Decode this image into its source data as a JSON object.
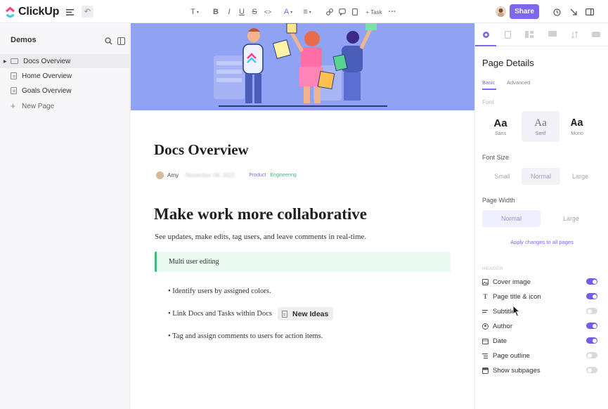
{
  "app": {
    "name": "ClickUp"
  },
  "toolbar": {
    "text_format": "T",
    "bold": "B",
    "italic": "I",
    "underline": "U",
    "strike": "S",
    "code": "<>",
    "text_color": "A",
    "align": "≡",
    "add_task": "+ Task",
    "more": "···",
    "share_label": "Share"
  },
  "sidebar": {
    "title": "Demos",
    "items": [
      {
        "label": "Docs Overview",
        "active": true
      },
      {
        "label": "Home Overview"
      },
      {
        "label": "Goals Overview"
      }
    ],
    "new_page": "New Page"
  },
  "doc": {
    "title": "Docs Overview",
    "author": "Amy",
    "date_blurred": "November 08, 2022",
    "tags": [
      "Product",
      "Engineering"
    ],
    "heading": "Make work more collaborative",
    "lead": "See updates, make edits, tag users, and leave comments in real-time.",
    "callout": "Multi user editing",
    "bullets": [
      "• Identify users by assigned colors.",
      "• Link Docs and Tasks within Docs",
      "• Tag and assign comments to users for action items."
    ],
    "linked_doc_chip": "New Ideas"
  },
  "panel": {
    "title": "Page Details",
    "subtabs": [
      "Basic",
      "Advanced"
    ],
    "font_label": "Font",
    "fonts": [
      {
        "glyph": "Aa",
        "name": "Sans"
      },
      {
        "glyph": "Aa",
        "name": "Serif",
        "selected": true
      },
      {
        "glyph": "Aa",
        "name": "Mono"
      }
    ],
    "font_size_label": "Font Size",
    "font_sizes": [
      "Small",
      "Normal",
      "Large"
    ],
    "font_size_selected": "Normal",
    "page_width_label": "Page Width",
    "page_widths": [
      "Normal",
      "Large"
    ],
    "page_width_selected": "Normal",
    "apply_label": "Apply changes to all pages",
    "header_label": "HEADER",
    "options": [
      {
        "label": "Cover image",
        "on": true,
        "icon": "image-icon"
      },
      {
        "label": "Page title & icon",
        "on": true,
        "icon": "text-icon"
      },
      {
        "label": "Subtitle",
        "on": false,
        "icon": "subtitle-icon"
      },
      {
        "label": "Author",
        "on": true,
        "icon": "user-icon"
      },
      {
        "label": "Date",
        "on": true,
        "icon": "calendar-icon"
      },
      {
        "label": "Page outline",
        "on": false,
        "icon": "outline-icon"
      },
      {
        "label": "Show subpages",
        "on": false,
        "icon": "subpages-icon"
      }
    ]
  },
  "colors": {
    "accent": "#7b68ee",
    "cover": "#8fa2f4",
    "callout_border": "#3fbd7c"
  }
}
